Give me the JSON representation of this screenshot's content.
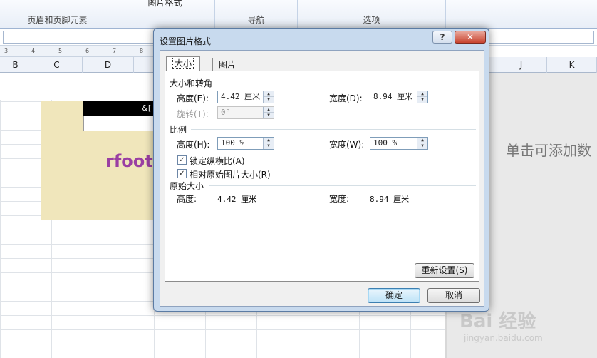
{
  "ribbon": {
    "top_label": "图片格式",
    "groups": [
      "页眉和页脚元素",
      "导航",
      "选项"
    ]
  },
  "ruler": {
    "ticks": [
      "3",
      "4",
      "5",
      "6",
      "7",
      "8"
    ]
  },
  "columns": [
    "B",
    "C",
    "D",
    "J",
    "K"
  ],
  "sheet": {
    "header_field": "&[",
    "rfoot_text": "rfoot",
    "click_to_add": "单击可添加数"
  },
  "watermark": {
    "line1": "Bai 经验",
    "line2": "jingyan.baidu.com"
  },
  "dialog": {
    "title": "设置图片格式",
    "help": "?",
    "close": "✕",
    "tabs": [
      "大小",
      "图片"
    ],
    "size_rotate": {
      "heading": "大小和转角",
      "height_label": "高度(E):",
      "height_value": "4.42 厘米",
      "width_label": "宽度(D):",
      "width_value": "8.94 厘米",
      "rotate_label": "旋转(T):",
      "rotate_value": "0°"
    },
    "scale": {
      "heading": "比例",
      "height_label": "高度(H):",
      "height_value": "100 %",
      "width_label": "宽度(W):",
      "width_value": "100 %",
      "lock_label": "锁定纵横比(A)",
      "relative_label": "相对原始图片大小(R)"
    },
    "original": {
      "heading": "原始大小",
      "height_label": "高度:",
      "height_value": "4.42 厘米",
      "width_label": "宽度:",
      "width_value": "8.94 厘米"
    },
    "reset": "重新设置(S)",
    "ok": "确定",
    "cancel": "取消"
  }
}
